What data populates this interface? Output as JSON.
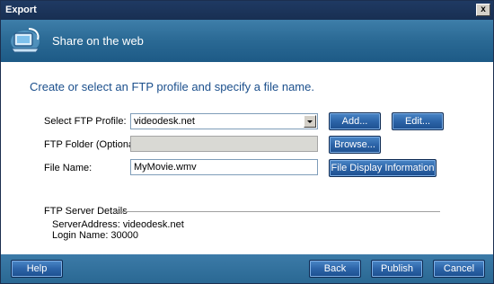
{
  "window": {
    "title": "Export",
    "close_glyph": "x"
  },
  "banner": {
    "title": "Share on the web",
    "icon": "share-web-icon"
  },
  "main": {
    "heading": "Create or select an FTP profile and specify a file name.",
    "ftp_profile_label": "Select FTP Profile:",
    "ftp_profile_value": "videodesk.net",
    "ftp_folder_label": "FTP Folder (Optional):",
    "ftp_folder_value": "",
    "file_name_label": "File Name:",
    "file_name_value": "MyMovie.wmv",
    "buttons": {
      "add": "Add...",
      "edit": "Edit...",
      "browse": "Browse...",
      "file_display": "File Display Information"
    }
  },
  "server": {
    "section_label": "FTP Server Details",
    "address": "ServerAddress: videodesk.net",
    "login": "Login Name: 30000"
  },
  "footer": {
    "help": "Help",
    "back": "Back",
    "publish": "Publish",
    "cancel": "Cancel"
  }
}
